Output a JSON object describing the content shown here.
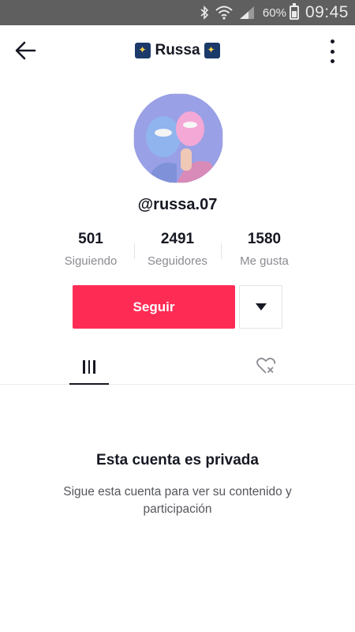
{
  "status_bar": {
    "battery_percent": "60%",
    "time": "09:45",
    "icons": [
      "bluetooth-icon",
      "wifi-icon",
      "signal-icon",
      "battery-icon"
    ]
  },
  "header": {
    "title": "Russa",
    "title_emoji": "sparkles-night-emoji",
    "back_icon": "back-arrow-icon",
    "more_icon": "more-vertical-icon"
  },
  "profile": {
    "username": "@russa.07",
    "stats": [
      {
        "value": "501",
        "label": "Siguiendo"
      },
      {
        "value": "2491",
        "label": "Seguidores"
      },
      {
        "value": "1580",
        "label": "Me gusta"
      }
    ]
  },
  "actions": {
    "follow_label": "Seguir",
    "dropdown_icon": "caret-down-icon"
  },
  "tabs": [
    {
      "name": "videos",
      "icon": "grid-icon",
      "active": true
    },
    {
      "name": "liked",
      "icon": "liked-locked-icon",
      "active": false
    }
  ],
  "private_notice": {
    "title": "Esta cuenta es privada",
    "subtitle": "Sigue esta cuenta para ver su contenido y participación"
  },
  "colors": {
    "accent": "#fe2c55",
    "status_bar": "#5f5f5f",
    "text_primary": "#161823",
    "text_secondary": "#8a8b91"
  }
}
